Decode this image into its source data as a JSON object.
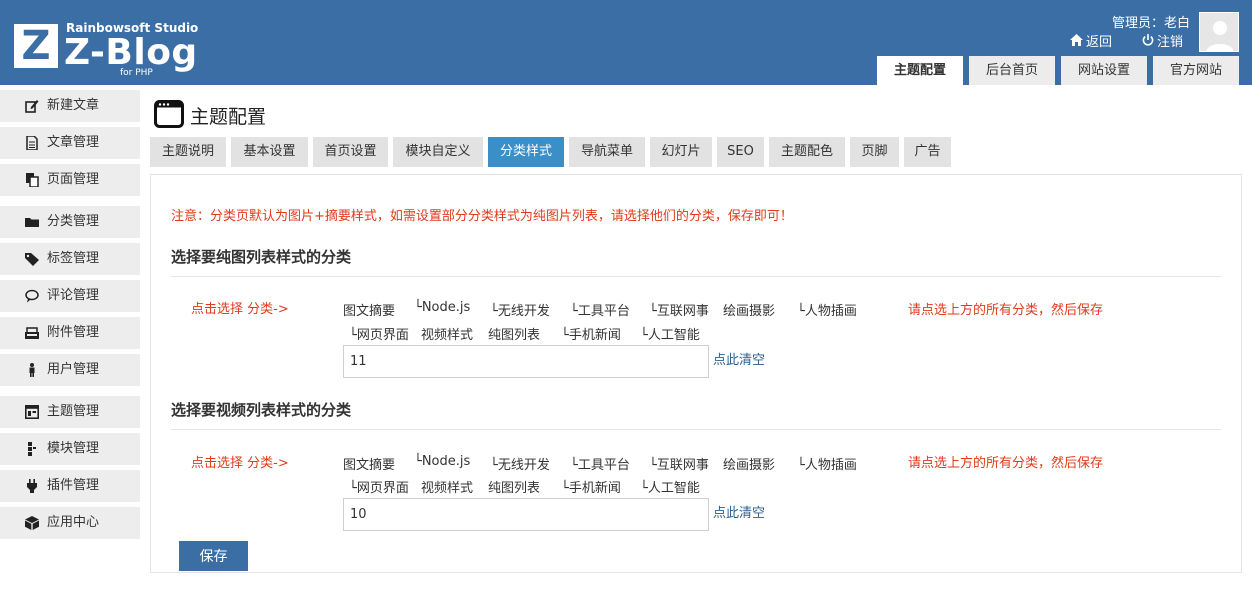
{
  "header": {
    "logo_studio": "Rainbowsoft Studio",
    "logo_name": "Z-Blog",
    "logo_for": "for PHP",
    "logo_letter": "Z",
    "admin_label": "管理员：老白",
    "back_label": "返回",
    "logout_label": "注销",
    "tabs": [
      "主题配置",
      "后台首页",
      "网站设置",
      "官方网站"
    ]
  },
  "sidebar": {
    "items": [
      {
        "label": "新建文章",
        "icon": "edit-icon"
      },
      {
        "label": "文章管理",
        "icon": "document-icon"
      },
      {
        "label": "页面管理",
        "icon": "pages-icon"
      },
      {
        "label": "分类管理",
        "icon": "folder-icon"
      },
      {
        "label": "标签管理",
        "icon": "tag-icon"
      },
      {
        "label": "评论管理",
        "icon": "comment-icon"
      },
      {
        "label": "附件管理",
        "icon": "attachment-icon"
      },
      {
        "label": "用户管理",
        "icon": "user-icon"
      },
      {
        "label": "主题管理",
        "icon": "theme-icon"
      },
      {
        "label": "模块管理",
        "icon": "module-icon"
      },
      {
        "label": "插件管理",
        "icon": "plugin-icon"
      },
      {
        "label": "应用中心",
        "icon": "app-center-icon"
      }
    ]
  },
  "main": {
    "title": "主题配置",
    "sub_tabs": [
      "主题说明",
      "基本设置",
      "首页设置",
      "模块自定义",
      "分类样式",
      "导航菜单",
      "幻灯片",
      "SEO",
      "主题配色",
      "页脚",
      "广告"
    ],
    "notice": "注意：分类页默认为图片+摘要样式，如需设置部分分类样式为纯图片列表，请选择他们的分类，保存即可！",
    "sections": [
      {
        "title": "选择要纯图列表样式的分类",
        "pick_label": "点击选择 分类->",
        "hint": "请点选上方的所有分类，然后保存",
        "categories_row1": [
          "图文摘要",
          "└Node.js",
          "└无线开发",
          "└工具平台",
          "└互联网事",
          "绘画摄影",
          "└人物插画"
        ],
        "categories_row2": [
          "└网页界面",
          "视频样式",
          "纯图列表",
          "└手机新闻",
          "└人工智能"
        ],
        "input_value": "11",
        "clear_label": "点此清空"
      },
      {
        "title": "选择要视频列表样式的分类",
        "pick_label": "点击选择 分类->",
        "hint": "请点选上方的所有分类，然后保存",
        "categories_row1": [
          "图文摘要",
          "└Node.js",
          "└无线开发",
          "└工具平台",
          "└互联网事",
          "绘画摄影",
          "└人物插画"
        ],
        "categories_row2": [
          "└网页界面",
          "视频样式",
          "纯图列表",
          "└手机新闻",
          "└人工智能"
        ],
        "input_value": "10",
        "clear_label": "点此清空"
      }
    ],
    "save_label": "保存"
  },
  "colors": {
    "brand": "#3a6ea5",
    "active_tab": "#3a8fc9",
    "notice": "#e03a1a",
    "link": "#2b5f8f"
  }
}
